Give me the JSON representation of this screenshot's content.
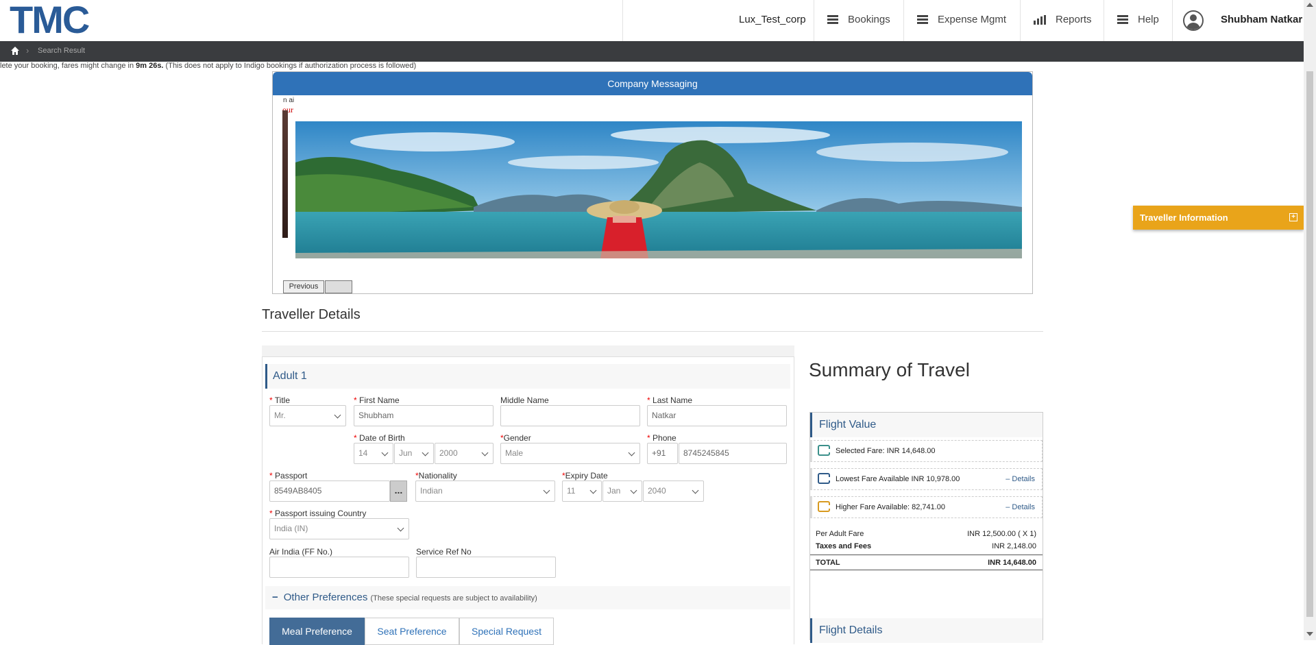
{
  "header": {
    "logo": "TMC",
    "corp_name": "Lux_Test_corp",
    "nav": [
      {
        "label": "Bookings",
        "icon": "menu-icon"
      },
      {
        "label": "Expense Mgmt",
        "icon": "menu-icon"
      },
      {
        "label": "Reports",
        "icon": "bar-chart-icon"
      },
      {
        "label": "Help",
        "icon": "menu-icon"
      }
    ],
    "user_name": "Shubham Natkar"
  },
  "breadcrumb": {
    "current": "Search Result"
  },
  "timer": {
    "prefix": "lete your booking, fares might change in ",
    "time": "9m 26s.",
    "suffix": " (This does not apply to Indigo bookings if authorization process is followed)"
  },
  "company_messaging": {
    "title": "Company Messaging",
    "fragment1": "n ai",
    "fragment2": "our",
    "prev_label": "Previous",
    "next_label": ""
  },
  "traveller_info_tab": {
    "label": "Traveller Information"
  },
  "traveller_details": {
    "title": "Traveller Details",
    "adult_heading": "Adult 1",
    "labels": {
      "title": "Title",
      "first_name": "First Name",
      "middle_name": "Middle Name",
      "last_name": "Last Name",
      "dob": "Date of Birth",
      "gender": "Gender",
      "phone": "Phone",
      "passport": "Passport",
      "nationality": "Nationality",
      "expiry": "Expiry Date",
      "passport_country": "Passport issuing Country",
      "ff_no": "Air India (FF No.)",
      "service_ref": "Service Ref No"
    },
    "values": {
      "title": "Mr.",
      "first_name": "Shubham",
      "middle_name": "",
      "last_name": "Natkar",
      "dob_day": "14",
      "dob_month": "Jun",
      "dob_year": "2000",
      "gender": "Male",
      "phone_code": "+91",
      "phone": "8745245845",
      "passport": "8549AB8405",
      "nationality": "Indian",
      "exp_day": "11",
      "exp_month": "Jan",
      "exp_year": "2040",
      "passport_country": "India (IN)",
      "ff_no": "",
      "service_ref": ""
    },
    "dots_label": "...",
    "other_prefs": {
      "label": "Other Preferences",
      "note": "(These special requests are subject to availability)"
    },
    "tabs": [
      "Meal Preference",
      "Seat Preference",
      "Special Request"
    ]
  },
  "summary": {
    "title": "Summary of Travel",
    "flight_value_heading": "Flight Value",
    "selected_fare": "Selected Fare: INR 14,648.00",
    "lowest_fare": "Lowest Fare Available INR 10,978.00",
    "higher_fare": "Higher Fare Available: 82,741.00",
    "details_label": "– Details",
    "per_adult_label": "Per Adult Fare",
    "per_adult_value": "INR 12,500.00 ( X 1)",
    "taxes_label": "Taxes and Fees",
    "taxes_value": "INR 2,148.00",
    "total_label": "TOTAL",
    "total_value": "INR 14,648.00",
    "flight_details_heading": "Flight Details"
  }
}
